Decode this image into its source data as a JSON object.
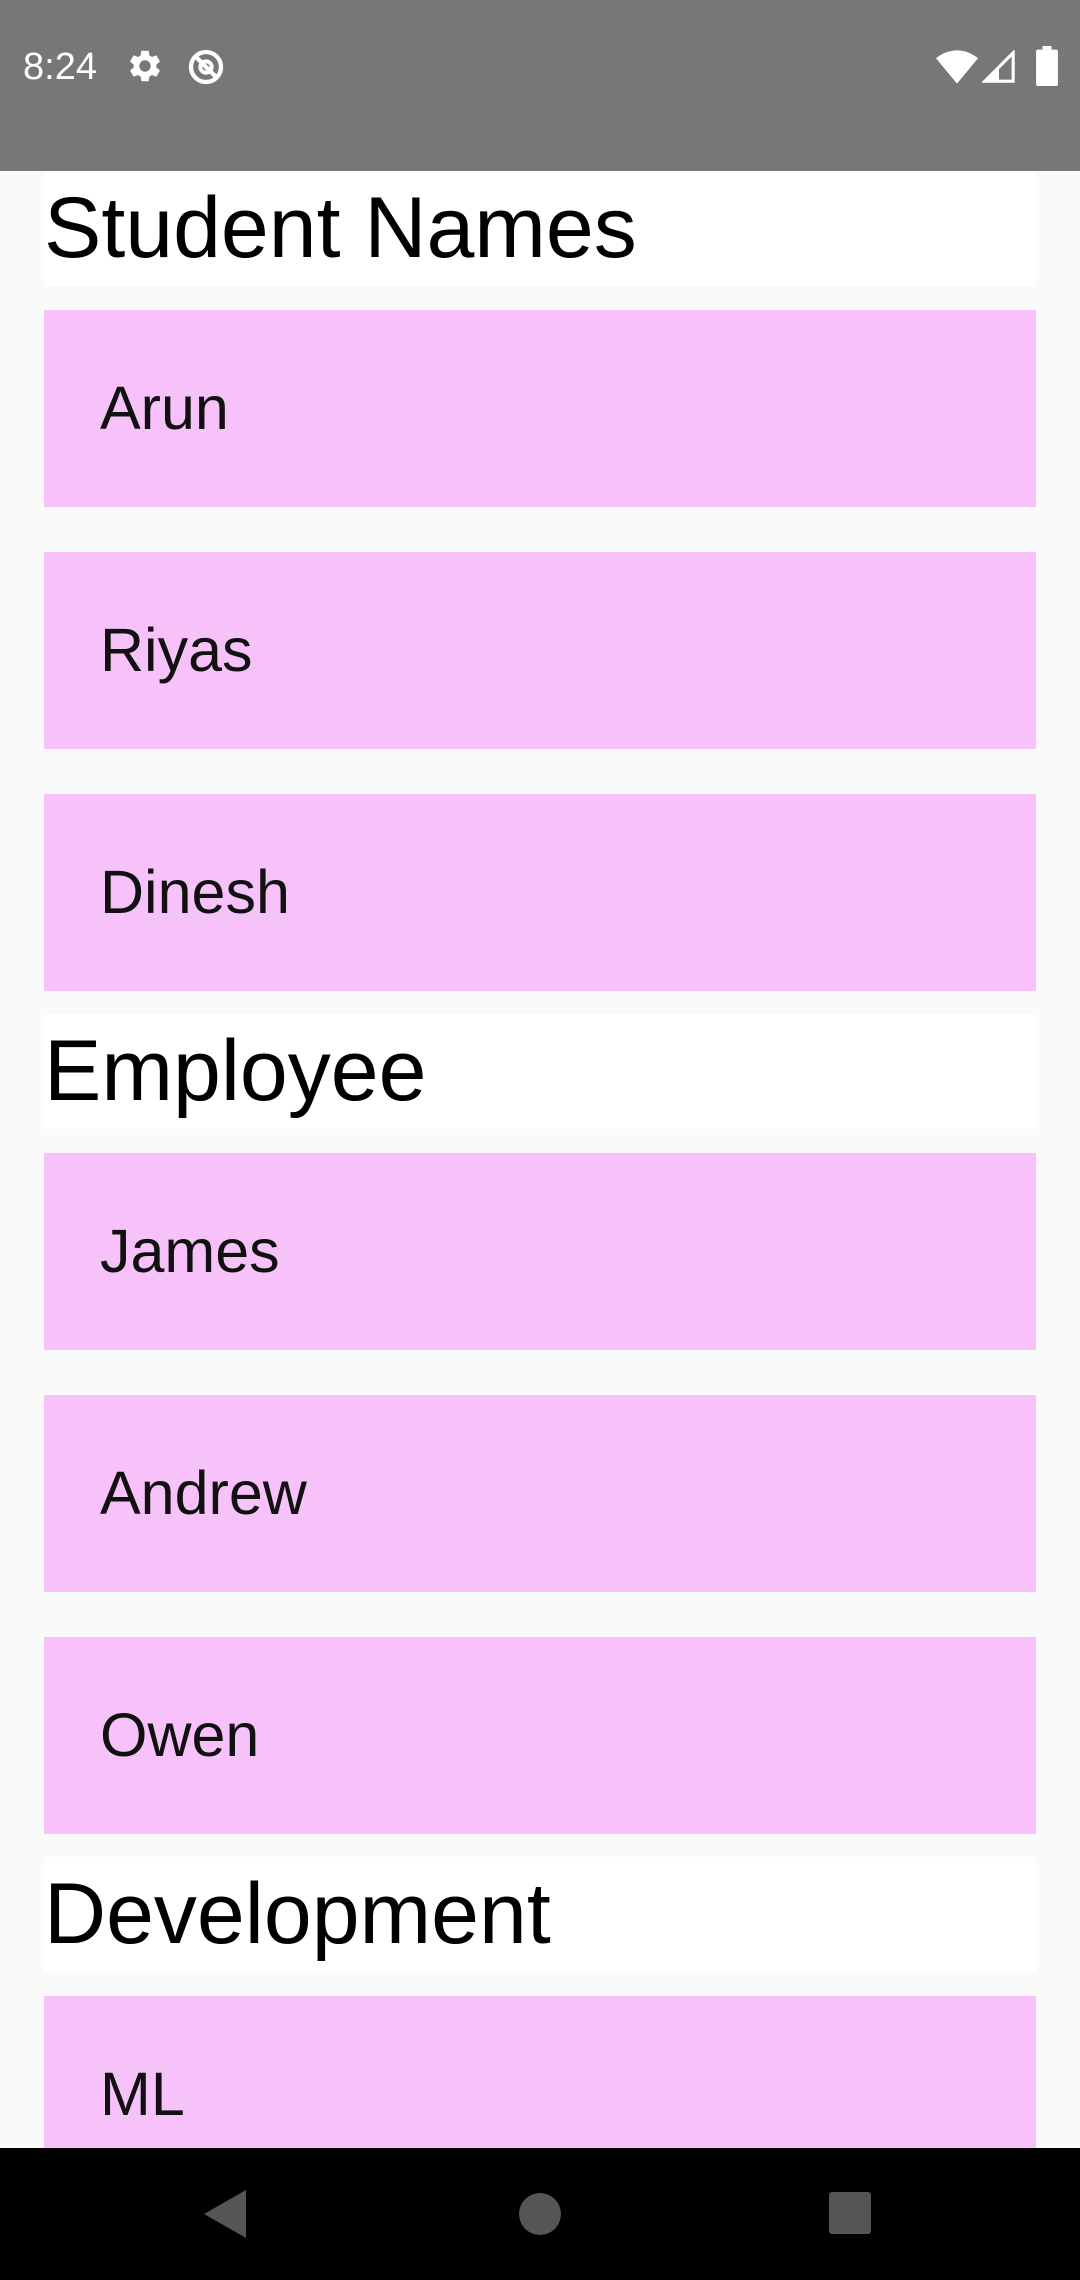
{
  "status_bar": {
    "time": "8:24",
    "icons": [
      "gear-icon",
      "no-sync-icon",
      "wifi-icon",
      "cellular-signal-icon",
      "battery-icon"
    ],
    "background": "#777777"
  },
  "sections": [
    {
      "title": "Student Names",
      "items": [
        "Arun",
        "Riyas",
        "Dinesh"
      ]
    },
    {
      "title": "Employee",
      "items": [
        "James",
        "Andrew",
        "Owen"
      ]
    },
    {
      "title": "Development",
      "items": [
        "ML"
      ]
    }
  ],
  "colors": {
    "item_background": "#f7c2fa",
    "header_background": "#ffffff",
    "page_background": "#fafafa",
    "nav_background": "#000000"
  },
  "nav_bar": {
    "buttons": [
      "back-icon",
      "home-icon",
      "recents-icon"
    ]
  }
}
